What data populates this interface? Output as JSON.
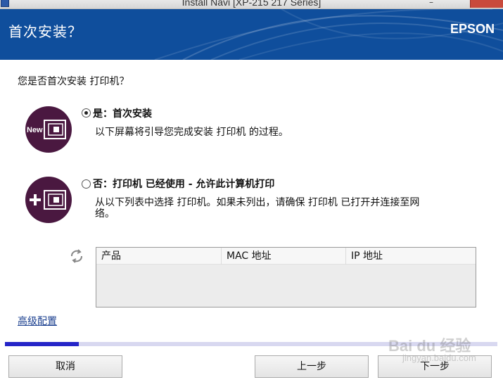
{
  "window": {
    "title": "Install Navi [XP-215 217 Series]",
    "minimize_glyph": "–"
  },
  "header": {
    "title": "首次安装？",
    "brand": "EPSON",
    "background_color": "#0f4e9c"
  },
  "content": {
    "question": "您是否首次安装 打印机？",
    "options": [
      {
        "label": "是：首次安装",
        "description": "以下屏幕将引导您完成安装 打印机 的过程。",
        "selected": true,
        "icon": "new-printer-icon",
        "icon_text": "New"
      },
      {
        "label": "否：打印机 已经使用 - 允许此计算机打印",
        "description_line1": "从以下列表中选择 打印机。如果未列出，请确保 打印机 已打开并连接至网",
        "description_line2": "络。",
        "selected": false,
        "icon": "add-printer-icon"
      }
    ],
    "table": {
      "columns": [
        "产品",
        "MAC 地址",
        "IP 地址"
      ],
      "rows": []
    },
    "refresh_icon": "refresh-icon",
    "advanced_link": "高级配置"
  },
  "progress": {
    "value": 0.15,
    "fill_color": "#2525c8"
  },
  "footer": {
    "cancel_label": "取消",
    "back_label": "上一步",
    "next_label": "下一步"
  },
  "watermark": {
    "text": "Bai du 经验",
    "sub": "jingyan.baidu.com"
  }
}
